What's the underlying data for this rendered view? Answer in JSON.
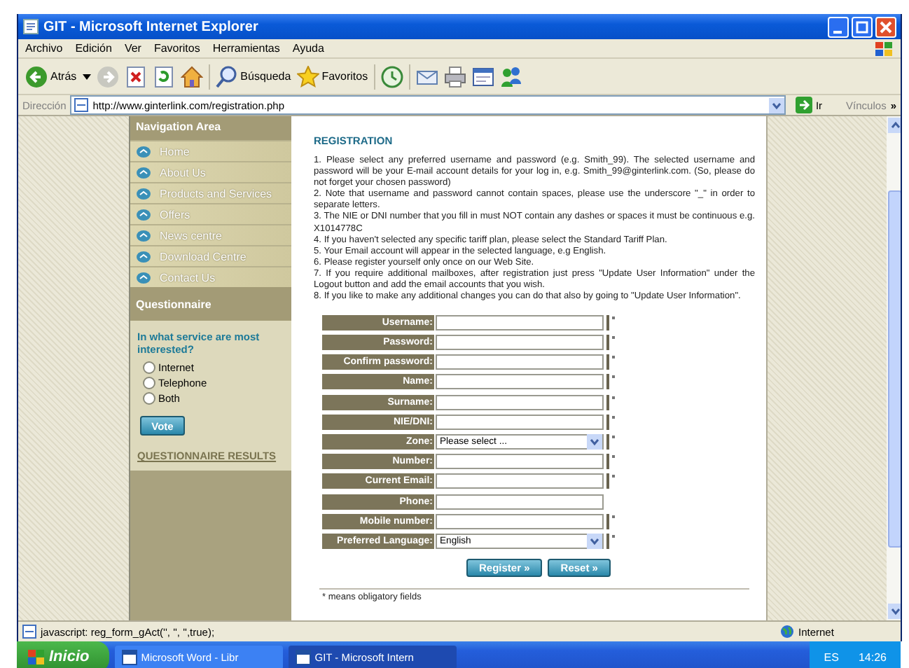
{
  "window": {
    "title": "GIT - Microsoft Internet Explorer"
  },
  "menu": [
    "Archivo",
    "Edición",
    "Ver",
    "Favoritos",
    "Herramientas",
    "Ayuda"
  ],
  "toolbar": [
    {
      "kind": "back",
      "label": "Atrás"
    },
    {
      "kind": "forward"
    },
    {
      "kind": "stop"
    },
    {
      "kind": "refresh"
    },
    {
      "kind": "home"
    },
    {
      "kind": "search",
      "label": "Búsqueda"
    },
    {
      "kind": "favorites",
      "label": "Favoritos"
    },
    {
      "kind": "history"
    },
    {
      "kind": "mail"
    },
    {
      "kind": "print"
    },
    {
      "kind": "edit"
    },
    {
      "kind": "messenger"
    }
  ],
  "address": {
    "label": "Dirección",
    "url": "http://www.ginterlink.com/registration.php",
    "go": "Ir",
    "links": "Vínculos",
    "more": "»"
  },
  "nav": {
    "title": "Navigation Area",
    "items": [
      "Home",
      "About Us",
      "Products and Services",
      "Offers",
      "News centre",
      "Download Centre",
      "Contact Us"
    ],
    "questionnaire": {
      "title": "Questionnaire",
      "question": "In what service are most interested?",
      "options": [
        {
          "label": "Internet",
          "selected": false
        },
        {
          "label": "Telephone",
          "selected": false
        },
        {
          "label": "Both",
          "selected": false
        }
      ],
      "vote": "Vote",
      "results": "QUESTIONNAIRE RESULTS"
    }
  },
  "registration": {
    "title": "REGISTRATION",
    "instructions": [
      "1. Please select any preferred username and password (e.g. Smith_99). The selected username and password will be your E-mail account details for your log in, e.g. Smith_99@ginterlink.com. (So, please do not forget your chosen password)",
      "2. Note that username and password cannot contain spaces, please use the underscore \"_\" in order to separate letters.",
      "3. The NIE or DNI number that you fill in must NOT contain any dashes or spaces it must be continuous e.g. X1014778C",
      "4. If you haven't selected any specific tariff plan, please select the Standard Tariff Plan.",
      "5. Your Email account will appear in the selected language, e.g English.",
      "6. Please register yourself only once on our Web Site.",
      "7. If you require additional mailboxes, after registration just press \"Update User Information\" under the Logout button and add the email accounts that you wish.",
      "8. If you like to make any additional changes you can do that also by going to \"Update User Information\"."
    ],
    "fields": [
      {
        "label": "Username:",
        "kind": "text",
        "required": true
      },
      {
        "label": "Password:",
        "kind": "text",
        "required": true
      },
      {
        "label": "Confirm password:",
        "kind": "text",
        "required": true
      },
      {
        "label": "Name:",
        "kind": "text",
        "required": true
      },
      {
        "label": "Surname:",
        "kind": "text",
        "required": true
      },
      {
        "label": "NIE/DNI:",
        "kind": "text",
        "required": true
      },
      {
        "label": "Zone:",
        "kind": "select",
        "value": "Please select ...",
        "required": true
      },
      {
        "label": "Number:",
        "kind": "text",
        "required": true
      },
      {
        "label": "Current Email:",
        "kind": "text",
        "required": true
      },
      {
        "label": "Phone:",
        "kind": "text",
        "required": false
      },
      {
        "label": "Mobile number:",
        "kind": "text",
        "required": true
      },
      {
        "label": "Preferred Language:",
        "kind": "select",
        "value": "English",
        "required": true
      }
    ],
    "buttons": [
      "Register »",
      "Reset »"
    ],
    "note": "* means obligatory fields"
  },
  "status_bar": {
    "text": "javascript: reg_form_gAct('', '', '',true);",
    "zone": "Internet"
  },
  "taskbar": {
    "start": "Inicio",
    "tasks": [
      {
        "label": "Microsoft Word - Libr",
        "selected": false
      },
      {
        "label": "GIT - Microsoft Intern",
        "selected": true
      }
    ],
    "language": "ES",
    "time": "14:26"
  }
}
